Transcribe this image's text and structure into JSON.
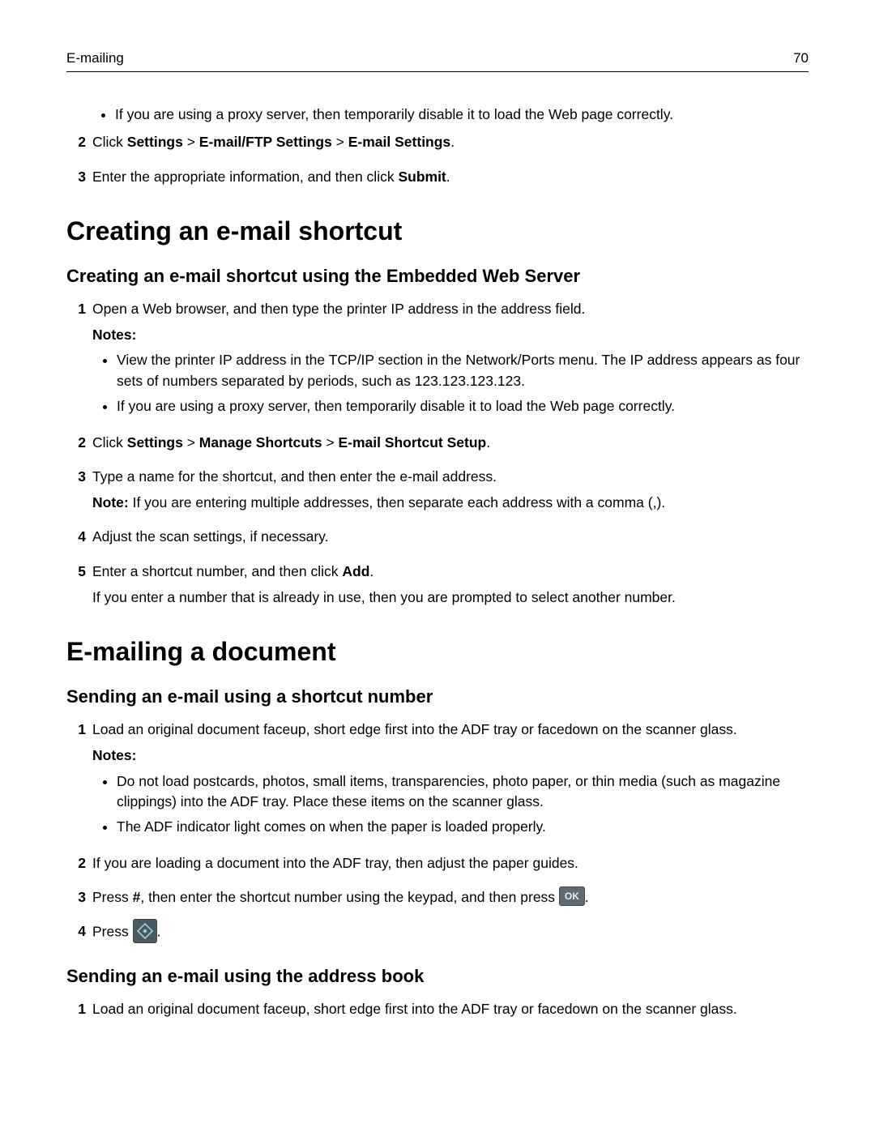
{
  "header": {
    "left": "E-mailing",
    "right": "70"
  },
  "pre": {
    "bullet1": "If you are using a proxy server, then temporarily disable it to load the Web page correctly.",
    "step2_prefix": "Click ",
    "step2_b1": "Settings",
    "step2_sep": " > ",
    "step2_b2": "E-mail/FTP Settings",
    "step2_b3": "E-mail Settings",
    "step2_period": ".",
    "step3_a": "Enter the appropriate information, and then click ",
    "step3_b": "Submit",
    "step3_c": "."
  },
  "s1": {
    "h1": "Creating an e-mail shortcut",
    "h2": "Creating an e-mail shortcut using the Embedded Web Server",
    "step1": "Open a Web browser, and then type the printer IP address in the address field.",
    "notes_label": "Notes:",
    "note_a": "View the printer IP address in the TCP/IP section in the Network/Ports menu. The IP address appears as four sets of numbers separated by periods, such as 123.123.123.123.",
    "note_b": "If you are using a proxy server, then temporarily disable it to load the Web page correctly.",
    "step2_prefix": "Click ",
    "step2_b1": "Settings",
    "step2_sep": " > ",
    "step2_b2": "Manage Shortcuts",
    "step2_b3": "E-mail Shortcut Setup",
    "step2_period": ".",
    "step3": "Type a name for the shortcut, and then enter the e-mail address.",
    "step3_note_b": "Note: ",
    "step3_note_t": "If you are entering multiple addresses, then separate each address with a comma (,).",
    "step4": "Adjust the scan settings, if necessary.",
    "step5_a": "Enter a shortcut number, and then click ",
    "step5_b": "Add",
    "step5_c": ".",
    "step5_p2": "If you enter a number that is already in use, then you are prompted to select another number."
  },
  "s2": {
    "h1": "E-mailing a document",
    "h2a": "Sending an e-mail using a shortcut number",
    "a_step1": "Load an original document faceup, short edge first into the ADF tray or facedown on the scanner glass.",
    "a_notes_label": "Notes:",
    "a_note_a": "Do not load postcards, photos, small items, transparencies, photo paper, or thin media (such as magazine clippings) into the ADF tray. Place these items on the scanner glass.",
    "a_note_b": "The ADF indicator light comes on when the paper is loaded properly.",
    "a_step2": "If you are loading a document into the ADF tray, then adjust the paper guides.",
    "a_step3_a": "Press ",
    "a_step3_hash": "#",
    "a_step3_b": ", then enter the shortcut number using the keypad, and then press ",
    "a_step3_c": ".",
    "ok_label": "OK",
    "a_step4_a": "Press ",
    "a_step4_b": ".",
    "h2b": "Sending an e-mail using the address book",
    "b_step1": "Load an original document faceup, short edge first into the ADF tray or facedown on the scanner glass."
  }
}
